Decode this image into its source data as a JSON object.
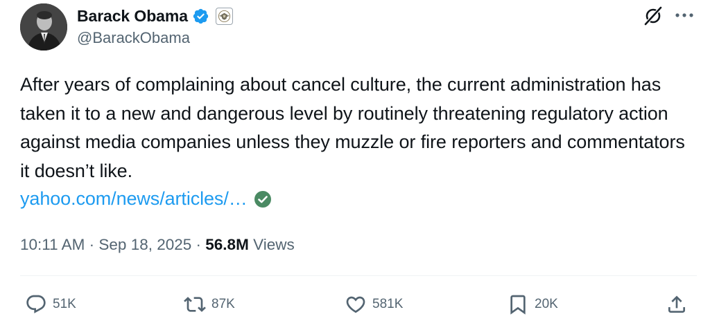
{
  "author": {
    "name": "Barack Obama",
    "handle": "@BarackObama",
    "verified_badge_color": "#1d9bf0"
  },
  "tweet": {
    "text": "After years of complaining about cancel culture, the current administration has taken it to a new and dangerous level by routinely threatening regulatory action against media companies unless they muzzle or fire reporters and commentators it doesn’t like.",
    "link_text": "yahoo.com/news/articles/…",
    "link_color": "#1d9bf0"
  },
  "meta": {
    "time": "10:11 AM",
    "separator": " · ",
    "date": "Sep 18, 2025",
    "views_count": "56.8M",
    "views_label": "Views"
  },
  "actions": {
    "replies": "51K",
    "reposts": "87K",
    "likes": "581K",
    "bookmarks": "20K"
  },
  "icons": {
    "header": [
      "grok-icon",
      "more-icon"
    ],
    "actions": [
      "reply-icon",
      "repost-icon",
      "like-icon",
      "bookmark-icon",
      "share-icon"
    ]
  },
  "colors": {
    "text_primary": "#0f1419",
    "text_secondary": "#536471",
    "divider": "#eff3f4",
    "link_check": "#4a8a63"
  }
}
